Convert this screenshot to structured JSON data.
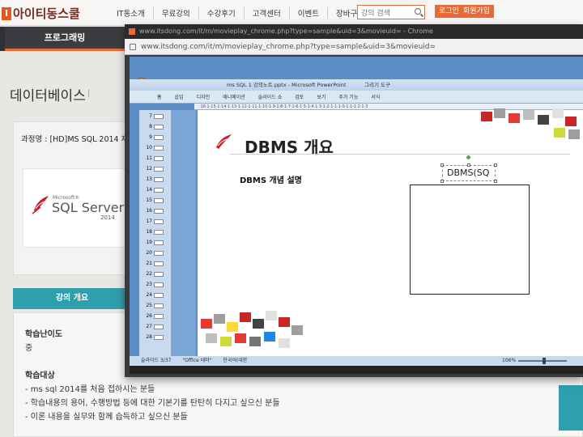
{
  "site": {
    "logo_text": "아이티동스쿨",
    "nav": [
      "IT동소개",
      "무료강의",
      "수강후기",
      "고객센터",
      "이벤트",
      "장바구니"
    ],
    "search_placeholder": "강의 검색",
    "login": "로그인",
    "join": "회원가입",
    "category_tab": "프로그래밍",
    "page_title": "데이터베이스",
    "course_label": "과정명 : [HD]MS SQL 2014 제",
    "sql_logo": {
      "maker": "Microsoft®",
      "name": "SQL Server",
      "year": "2014"
    },
    "overview_tab": "강의 개요",
    "difficulty_label": "학습난이도",
    "difficulty_value": "중",
    "target_label": "학습대상",
    "target_items": [
      "- ms sql 2014를 처음 접하시는 분들",
      "- 학습내용의 용어, 수행방법 등에 대한 기본기를 탄탄히 다지고 싶으신 분들",
      "- 이론 내용을 실무와 함께 습득하고 싶으신 분들"
    ]
  },
  "popup": {
    "window_title": "www.itsdong.com/it/m/movieplay_chrome.php?type=sample&uid=3&movieuid= - Chrome",
    "address": "www.itsdong.com/it/m/movieplay_chrome.php?type=sample&uid=3&movieuid="
  },
  "powerpoint": {
    "title": "ms SQL 1 강의노트.pptx - Microsoft PowerPoint",
    "context_tab": "그리기 도구",
    "ribbon_tabs": [
      "홈",
      "삽입",
      "디자인",
      "애니메이션",
      "슬라이드 쇼",
      "검토",
      "보기",
      "추가 기능",
      "서식"
    ],
    "ruler": "·16·1·15·1·14·1·13·1·12·1·11·1·10·1·9·1·8·1·7·1·6·1·5·1·4·1·3·1·2·1·1·1·0·1·1·1·2·1·3",
    "slide_numbers": [
      "7",
      "8",
      "9",
      "10",
      "11",
      "12",
      "13",
      "14",
      "15",
      "16",
      "17",
      "18",
      "19",
      "20",
      "21",
      "22",
      "23",
      "24",
      "25",
      "26",
      "27",
      "28"
    ],
    "slide_title": "DBMS 개요",
    "slide_text": "DBMS 개념 설명",
    "textbox_text": "DBMS(SQ",
    "status": [
      "슬라이드 3/37",
      "\"Office 테마\"",
      "한국어(대한"
    ],
    "zoom": "106%"
  },
  "colors": {
    "accent": "#e86a36",
    "teal": "#2f9fae",
    "dark_bar": "#2f3134"
  }
}
